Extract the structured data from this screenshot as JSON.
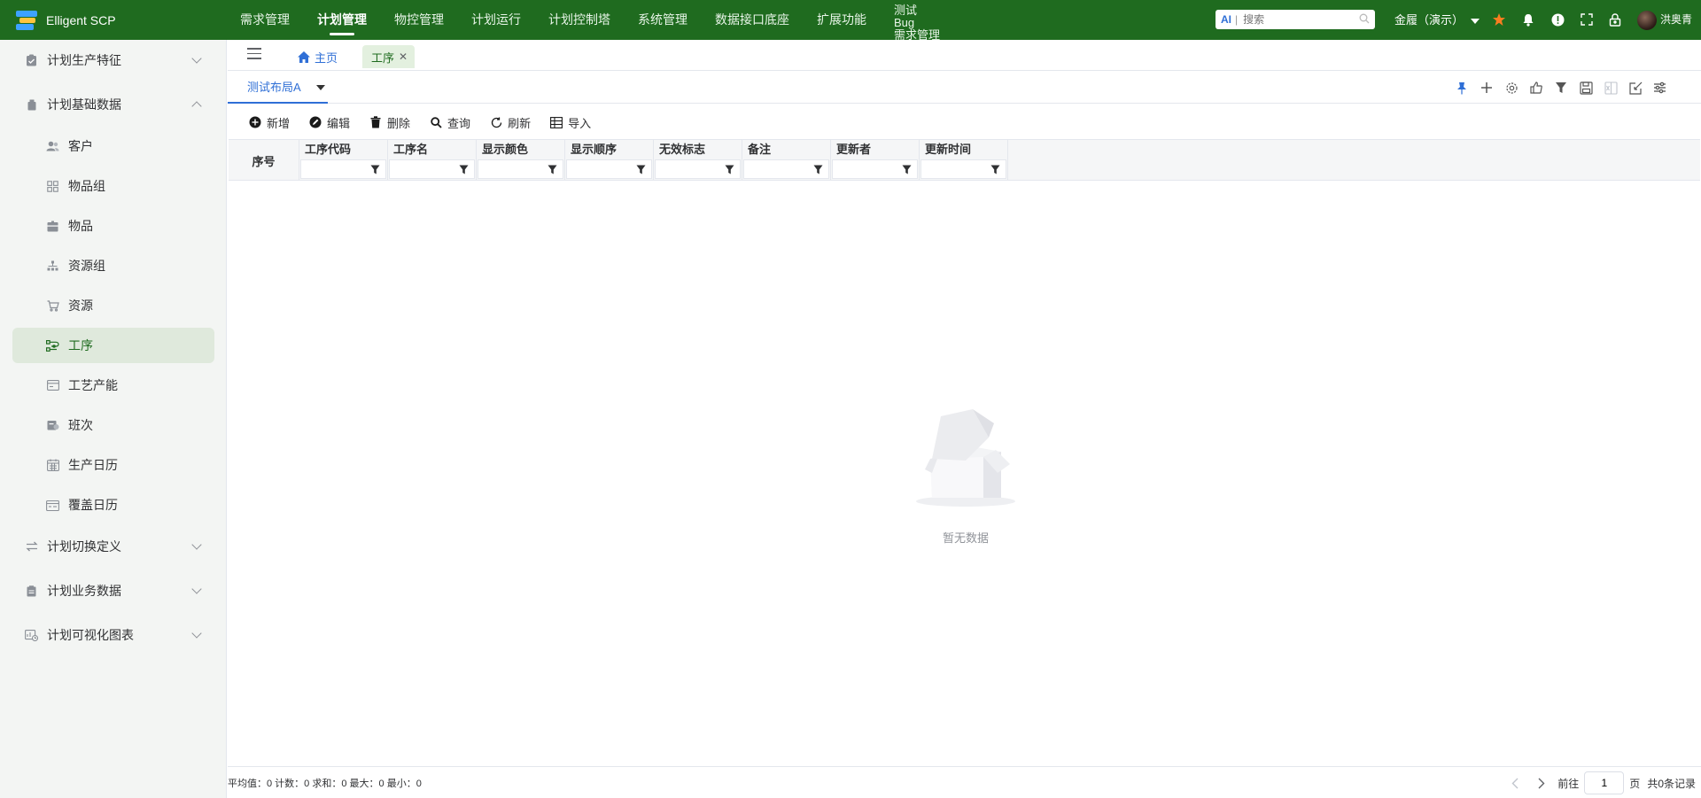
{
  "app": {
    "name": "Elligent SCP"
  },
  "topnav": [
    {
      "label": "需求管理",
      "active": false
    },
    {
      "label": "计划管理",
      "active": true
    },
    {
      "label": "物控管理",
      "active": false
    },
    {
      "label": "计划运行",
      "active": false
    },
    {
      "label": "计划控制塔",
      "active": false
    },
    {
      "label": "系统管理",
      "active": false
    },
    {
      "label": "数据接口底座",
      "active": false
    },
    {
      "label": "扩展功能",
      "active": false
    }
  ],
  "topnav_multi": {
    "line1": "测试",
    "line2": "Bug",
    "line3": "需求管理"
  },
  "search": {
    "ai_label": "AI",
    "placeholder": "搜索"
  },
  "tenant": {
    "label": "金履（演示）"
  },
  "user": {
    "name": "洪奥青"
  },
  "sidebar": {
    "groups": [
      {
        "label": "计划生产特征",
        "expanded": false,
        "icon": "clipboard-icon"
      },
      {
        "label": "计划基础数据",
        "expanded": true,
        "icon": "stack-icon"
      },
      {
        "label": "计划切换定义",
        "expanded": false,
        "icon": "swap-icon"
      },
      {
        "label": "计划业务数据",
        "expanded": false,
        "icon": "document-icon"
      },
      {
        "label": "计划可视化图表",
        "expanded": false,
        "icon": "chart-icon"
      }
    ],
    "items": [
      {
        "label": "客户",
        "icon": "users-icon",
        "active": false
      },
      {
        "label": "物品组",
        "icon": "grid-icon",
        "active": false
      },
      {
        "label": "物品",
        "icon": "box-icon",
        "active": false
      },
      {
        "label": "资源组",
        "icon": "hierarchy-icon",
        "active": false
      },
      {
        "label": "资源",
        "icon": "cart-icon",
        "active": false
      },
      {
        "label": "工序",
        "icon": "process-icon",
        "active": true
      },
      {
        "label": "工艺产能",
        "icon": "card-icon",
        "active": false
      },
      {
        "label": "班次",
        "icon": "shift-icon",
        "active": false
      },
      {
        "label": "生产日历",
        "icon": "calendar-icon",
        "active": false
      },
      {
        "label": "覆盖日历",
        "icon": "calendar-overlay-icon",
        "active": false
      }
    ]
  },
  "tabs": {
    "home": "主页",
    "current": "工序"
  },
  "layout": {
    "name": "测试布局A"
  },
  "toolbar": {
    "add": "新增",
    "edit": "编辑",
    "delete": "删除",
    "query": "查询",
    "refresh": "刷新",
    "import": "导入"
  },
  "table": {
    "seq_header": "序号",
    "columns": [
      "工序代码",
      "工序名",
      "显示颜色",
      "显示顺序",
      "无效标志",
      "备注",
      "更新者",
      "更新时间"
    ],
    "rows": []
  },
  "empty": {
    "text": "暂无数据"
  },
  "footer": {
    "stats": "平均值：0 计数：0 求和：0 最大：0 最小：0",
    "goto_label": "前往",
    "page": "1",
    "page_unit": "页",
    "total": "共0条记录"
  },
  "colors": {
    "brand": "#1f6b1f",
    "accent": "#2f6fd6",
    "star": "#fa7d20"
  }
}
